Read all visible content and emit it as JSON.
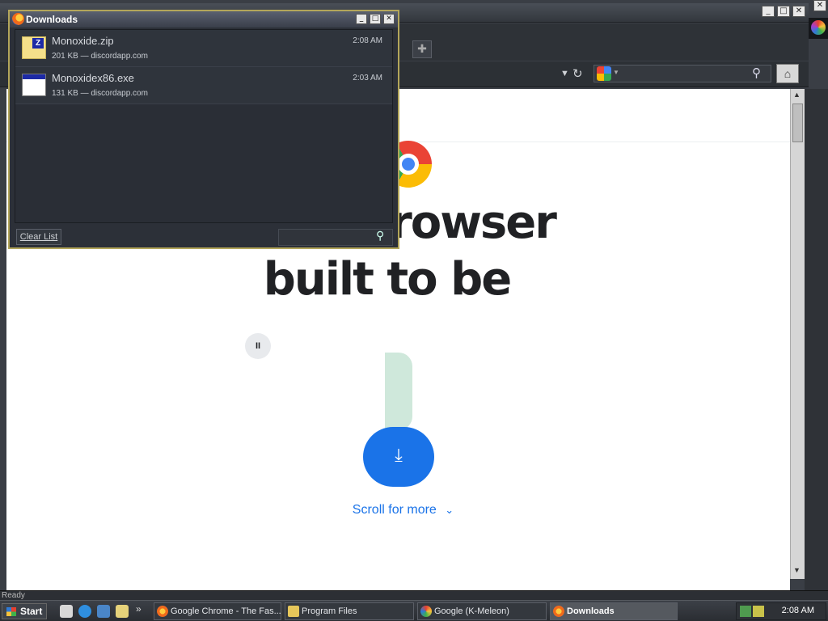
{
  "browser": {
    "status_text": "Ready",
    "new_tab_symbol": "✚",
    "home_symbol": "⌂",
    "page": {
      "headline_line1": "rowser",
      "headline_line2": "built to be",
      "pause_symbol": "II",
      "download_symbol": "⤓",
      "scroll_more": "Scroll for more",
      "scroll_chevron": "⌄"
    }
  },
  "downloads_window": {
    "title": "Downloads",
    "items": [
      {
        "name": "Monoxide.zip",
        "meta": "201 KB — discordapp.com",
        "time": "2:08 AM",
        "icon": "zip-file-icon"
      },
      {
        "name": "Monoxidex86.exe",
        "meta": "131 KB — discordapp.com",
        "time": "2:03 AM",
        "icon": "exe-file-icon"
      }
    ],
    "clear_label": "Clear List",
    "search_value": ""
  },
  "window_controls": {
    "minimize": "_",
    "maximize": "□",
    "close": "✕"
  },
  "taskbar": {
    "start_label": "Start",
    "quicklaunch_more": "»",
    "items": [
      {
        "label": "Google Chrome - The Fas...",
        "icon": "firefox-icon",
        "active": false
      },
      {
        "label": "Program Files",
        "icon": "folder-icon",
        "active": false
      },
      {
        "label": "Google (K-Meleon)",
        "icon": "kmeleon-icon",
        "active": false
      },
      {
        "label": "Downloads",
        "icon": "firefox-icon",
        "active": true
      }
    ],
    "clock": "2:08 AM"
  },
  "colors": {
    "accent_blue": "#1a73e8",
    "download_window_border": "#b3a65a",
    "page_bg": "#ffffff"
  }
}
